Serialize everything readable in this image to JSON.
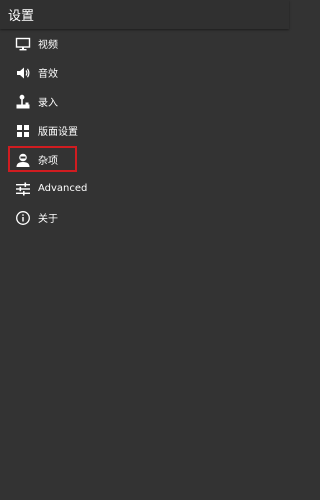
{
  "header": {
    "title": "设置"
  },
  "menu": {
    "items": [
      {
        "label": "视频",
        "icon": "monitor-icon"
      },
      {
        "label": "音效",
        "icon": "speaker-icon"
      },
      {
        "label": "录入",
        "icon": "joystick-icon"
      },
      {
        "label": "版面设置",
        "icon": "grid-icon"
      },
      {
        "label": "杂项",
        "icon": "user-icon",
        "highlighted": true
      },
      {
        "label": "Advanced",
        "icon": "sliders-icon"
      },
      {
        "label": "关于",
        "icon": "info-icon"
      }
    ]
  },
  "colors": {
    "background": "#333333",
    "header": "#303030",
    "text": "#ffffff",
    "highlight_border": "#d01c20"
  }
}
